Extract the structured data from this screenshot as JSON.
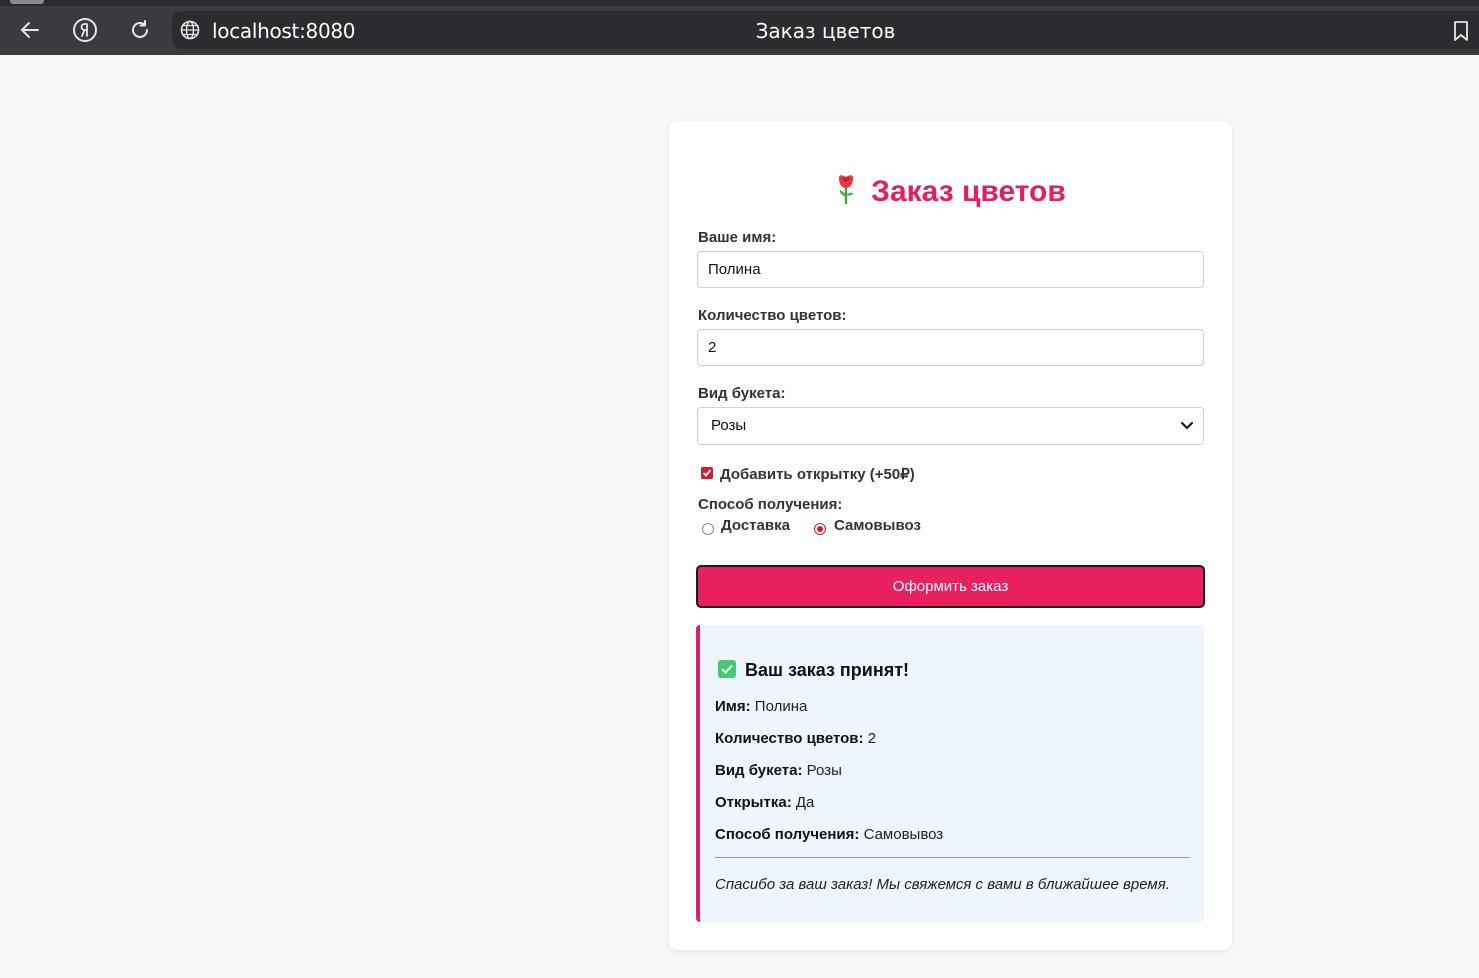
{
  "browser": {
    "url": "localhost:8080",
    "tab_title": "Заказ цветов"
  },
  "form": {
    "title": "Заказ цветов",
    "name_label": "Ваше имя:",
    "name_value": "Полина",
    "quantity_label": "Количество цветов:",
    "quantity_value": "2",
    "bouquet_label": "Вид букета:",
    "bouquet_selected": "Розы",
    "card_checkbox_label": "Добавить открытку (+50₽)",
    "card_checked": true,
    "delivery_label": "Способ получения:",
    "delivery_options": [
      "Доставка",
      "Самовывоз"
    ],
    "delivery_selected": "Самовывоз",
    "submit_label": "Оформить заказ"
  },
  "result": {
    "title": "Ваш заказ принят!",
    "rows": [
      {
        "label": "Имя:",
        "value": "Полина"
      },
      {
        "label": "Количество цветов:",
        "value": "2"
      },
      {
        "label": "Вид букета:",
        "value": "Розы"
      },
      {
        "label": "Открытка:",
        "value": "Да"
      },
      {
        "label": "Способ получения:",
        "value": "Самовывоз"
      }
    ],
    "thanks": "Спасибо за ваш заказ! Мы свяжемся с вами в ближайшее время."
  },
  "colors": {
    "accent": "#e0205f",
    "button": "#e8205f",
    "result_bg": "#eef5fd",
    "check": "#48c774"
  }
}
